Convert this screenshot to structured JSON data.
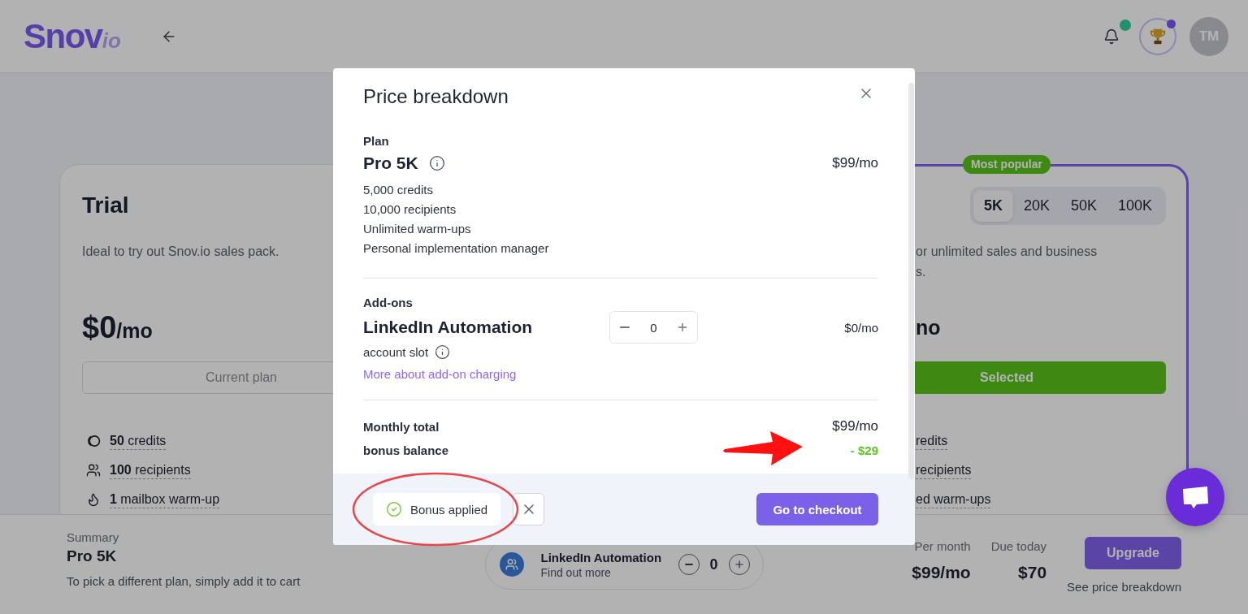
{
  "header": {
    "logo": {
      "text": "Snov",
      "suffix": "io"
    },
    "avatar": {
      "initials": "TM"
    }
  },
  "plans": [
    {
      "kind": "trial",
      "name": "Trial",
      "description": [
        "Ideal to try out Snov.io sales pack."
      ],
      "price": {
        "amount": "$0",
        "period": "/mo"
      },
      "button": {
        "kind": "outline",
        "label": "Current plan"
      },
      "features": [
        {
          "kind": "credits",
          "text": "**50** credits"
        },
        {
          "kind": "recipients",
          "text": "**100** recipients"
        },
        {
          "kind": "warmup",
          "text": "**1** mailbox warm-up"
        }
      ]
    },
    {
      "kind": "featured",
      "badge": "Most popular",
      "tiers": [
        {
          "label": "5K",
          "selected": true
        },
        {
          "label": "20K",
          "selected": false
        },
        {
          "label": "50K",
          "selected": false
        },
        {
          "label": "100K",
          "selected": false
        }
      ],
      "description": [
        "or unlimited sales and business",
        "s."
      ],
      "price": {
        "period": "no"
      },
      "button": {
        "kind": "filled",
        "label": "Selected"
      },
      "features": [
        {
          "text": "redits"
        },
        {
          "text": "recipients"
        },
        {
          "text": "ed warm-ups"
        }
      ]
    }
  ],
  "summary_bar": {
    "label": "Summary",
    "plan": "Pro 5K",
    "hint": "To pick a different plan, simply add it to cart",
    "addon": {
      "title": "LinkedIn Automation",
      "link": "Find out more",
      "quantity": "0"
    },
    "amounts": [
      {
        "label": "Per month",
        "value": "$99/mo"
      },
      {
        "label": "Due today",
        "value": "$70"
      }
    ],
    "upgrade_button": "Upgrade",
    "breakdown_link": "See price breakdown"
  },
  "modal": {
    "title": "Price breakdown",
    "plan": {
      "heading": "Plan",
      "name": "Pro 5K",
      "price": "$99/mo",
      "features": [
        "5,000 credits",
        "10,000 recipients",
        "Unlimited warm-ups",
        "Personal implementation manager"
      ]
    },
    "addon": {
      "heading": "Add-ons",
      "name": "LinkedIn Automation",
      "quantity": "0",
      "price": "$0/mo",
      "unit": "account slot",
      "link": "More about add-on charging"
    },
    "totals": [
      {
        "kind": "total",
        "label": "Monthly total",
        "value": "$99/mo"
      },
      {
        "kind": "discount",
        "label": "bonus balance",
        "value": "- $29"
      }
    ],
    "bonus_chip": "Bonus applied",
    "checkout_button": "Go to checkout"
  }
}
